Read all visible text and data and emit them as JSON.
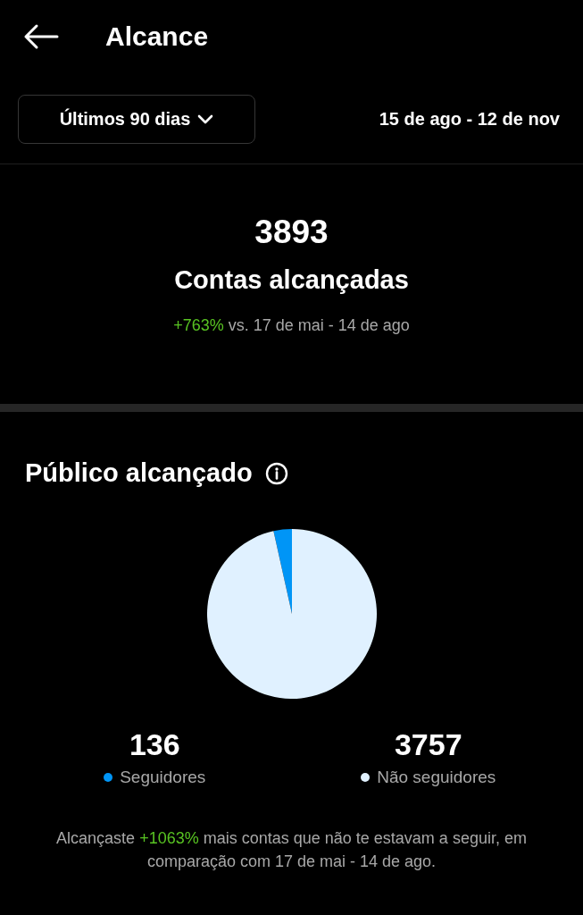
{
  "header": {
    "title": "Alcance"
  },
  "filter": {
    "period": "Últimos 90 dias",
    "range": "15 de ago - 12 de nov"
  },
  "summary": {
    "value": "3893",
    "label": "Contas alcançadas",
    "change": "+763%",
    "comparison": "vs. 17 de mai - 14 de ago"
  },
  "audience": {
    "title": "Público alcançado",
    "chart_data": {
      "type": "pie",
      "categories": [
        "Seguidores",
        "Não seguidores"
      ],
      "values": [
        3.49,
        96.51
      ]
    },
    "legend": [
      {
        "value": "136",
        "color": "#0095f6"
      },
      {
        "value": "3757",
        "color": "#e0f1ff"
      }
    ],
    "note_before": "Alcançaste",
    "note_change": "+1063%",
    "note_after": "mais contas que não te estavam a seguir, em comparação com 17 de mai - 14 de ago."
  }
}
